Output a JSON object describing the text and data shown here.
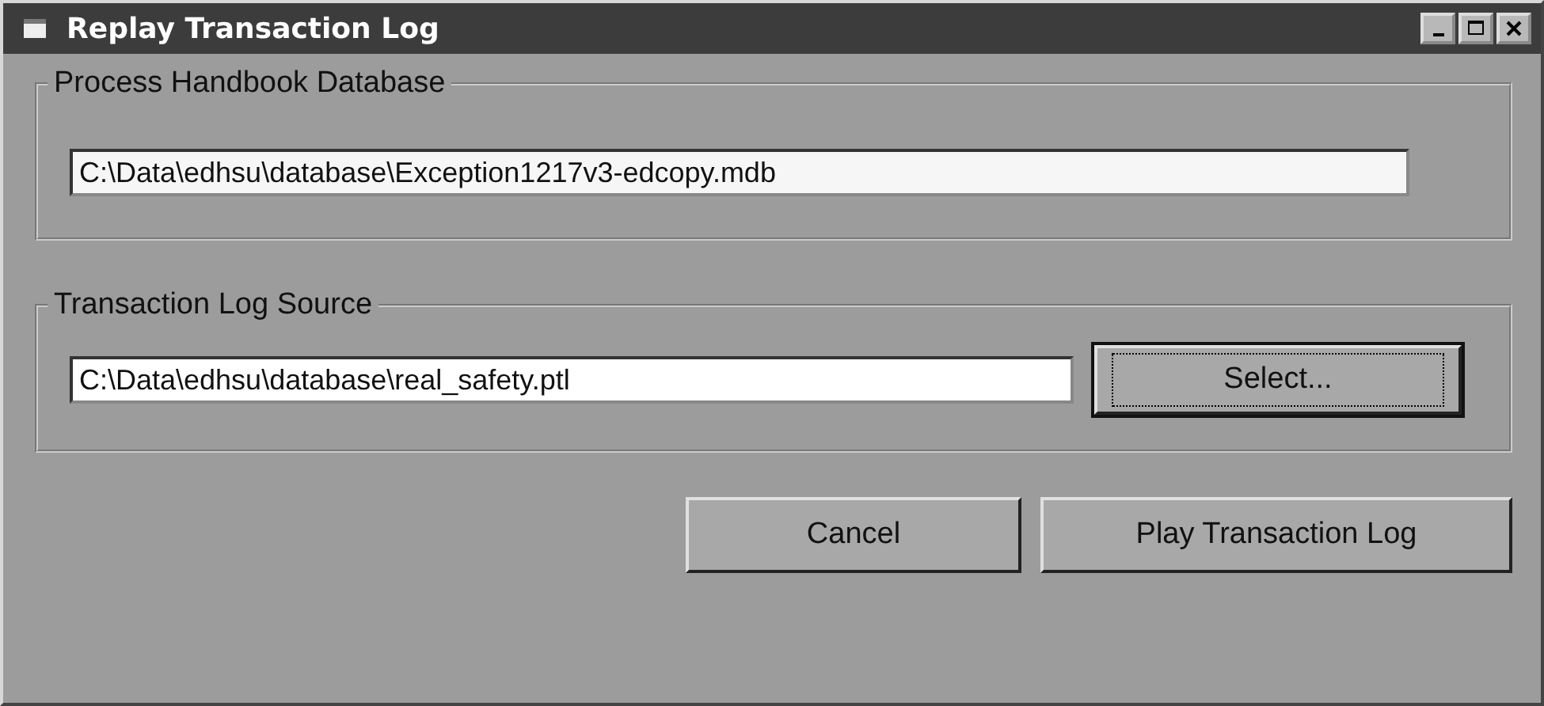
{
  "window": {
    "title": "Replay Transaction Log"
  },
  "groups": [
    {
      "label": "Process Handbook Database",
      "field": {
        "value": "C:\\Data\\edhsu\\database\\Exception1217v3-edcopy.mdb"
      }
    },
    {
      "label": "Transaction Log Source",
      "field": {
        "value": "C:\\Data\\edhsu\\database\\real_safety.ptl"
      },
      "button": {
        "label": "Select...",
        "focused": true
      }
    }
  ],
  "buttons": [
    {
      "label": "Cancel",
      "focused": false
    },
    {
      "label": "Play Transaction Log",
      "focused": false
    }
  ]
}
